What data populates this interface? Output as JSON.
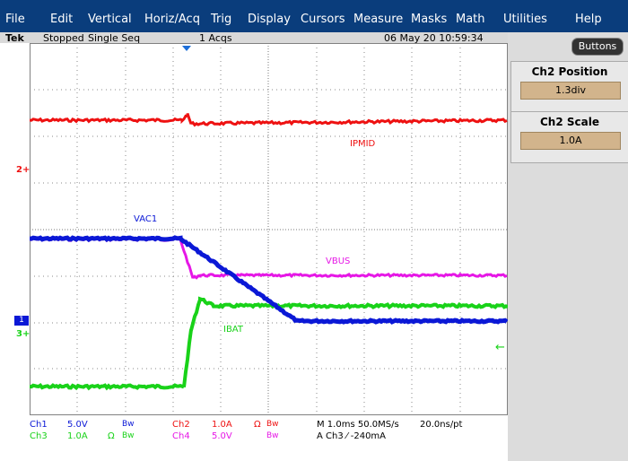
{
  "menu": [
    "File",
    "Edit",
    "Vertical",
    "Horiz/Acq",
    "Trig",
    "Display",
    "Cursors",
    "Measure",
    "Masks",
    "Math",
    "Utilities",
    "Help"
  ],
  "status": {
    "brand": "Tek",
    "run_state": "Stopped",
    "seq": "Single Seq",
    "acqs": "1 Acqs",
    "datetime": "06 May 20 10:59:34"
  },
  "right_panel": {
    "buttons_label": "Buttons",
    "position_title": "Ch2 Position",
    "position_value": "1.3div",
    "scale_title": "Ch2 Scale",
    "scale_value": "1.0A"
  },
  "traces": {
    "ipmid": "IPMID",
    "vac1": "VAC1",
    "vbus": "VBUS",
    "ibat": "IBAT"
  },
  "markers": {
    "ch2": "2",
    "ch1": "1",
    "ch3": "3"
  },
  "readouts": {
    "ch1_name": "Ch1",
    "ch1_scale": "5.0V",
    "ch1_bw": "Bw",
    "ch2_name": "Ch2",
    "ch2_scale": "1.0A",
    "ch2_ohm": "Ω",
    "ch2_bw": "Bw",
    "ch3_name": "Ch3",
    "ch3_scale": "1.0A",
    "ch3_ohm": "Ω",
    "ch3_bw": "Bw",
    "ch4_name": "Ch4",
    "ch4_scale": "5.0V",
    "ch4_bw": "Bw",
    "timebase": "M 1.0ms 50.0MS/s",
    "resolution": "20.0ns/pt",
    "trigger": "A  Ch3  ⁄  -240mA"
  },
  "colors": {
    "ch1": "#0b18d6",
    "ch2": "#ee1111",
    "ch3": "#19d219",
    "ch4": "#e617e6",
    "menubar": "#0a3d7c"
  }
}
